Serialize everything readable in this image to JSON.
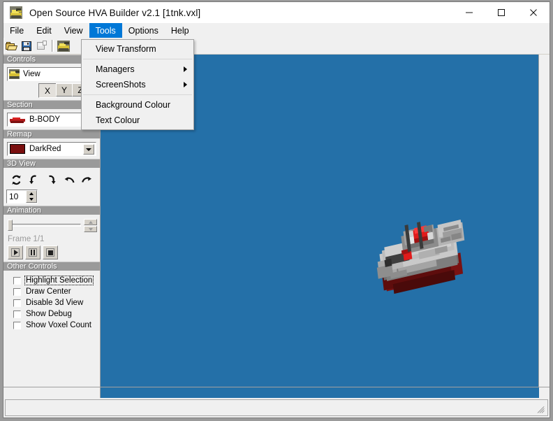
{
  "window": {
    "title": "Open Source HVA Builder v2.1 [1tnk.vxl]",
    "icon": "tank-icon",
    "minimize": "—",
    "maximize": "□",
    "close": "✕"
  },
  "menubar": {
    "items": [
      {
        "label": "File",
        "active": false
      },
      {
        "label": "Edit",
        "active": false
      },
      {
        "label": "View",
        "active": false
      },
      {
        "label": "Tools",
        "active": true
      },
      {
        "label": "Options",
        "active": false
      },
      {
        "label": "Help",
        "active": false
      }
    ]
  },
  "toolbar": {
    "buttons": [
      {
        "name": "open-file-button",
        "icon": "open-folder-icon",
        "enabled": true
      },
      {
        "name": "save-file-button",
        "icon": "floppy-disk-icon",
        "enabled": true
      },
      {
        "name": "save-as-button",
        "icon": "save-as-icon",
        "enabled": false
      },
      {
        "name": "voxel-preview-button",
        "icon": "tank-icon",
        "enabled": true
      },
      {
        "name": "undo-button",
        "icon": "undo-arrow-icon",
        "enabled": false
      },
      {
        "name": "redo-button",
        "icon": "redo-arrow-icon",
        "enabled": false
      }
    ]
  },
  "tools_menu": {
    "items": [
      {
        "label": "View Transform",
        "submenu": false
      },
      {
        "label": "Managers",
        "submenu": true
      },
      {
        "label": "ScreenShots",
        "submenu": true
      },
      {
        "label": "Background Colour",
        "submenu": false
      },
      {
        "label": "Text Colour",
        "submenu": false
      }
    ]
  },
  "sidebar": {
    "groups": [
      {
        "title": "Controls"
      },
      {
        "title": "Section"
      },
      {
        "title": "Remap"
      },
      {
        "title": "3D View"
      },
      {
        "title": "Animation"
      },
      {
        "title": "Other Controls"
      }
    ],
    "controls": {
      "view_label": "View",
      "axis_buttons": [
        {
          "label": "X",
          "selected": true
        },
        {
          "label": "Y",
          "selected": false
        },
        {
          "label": "Z",
          "selected": false
        }
      ]
    },
    "section": {
      "selected": "B-BODY",
      "swatch": "#b11b1b"
    },
    "remap": {
      "selected": "DarkRed",
      "swatch": "#7a0f0f"
    },
    "view3d": {
      "rotate_buttons": [
        "rotate-reset-icon",
        "rotate-left-down-icon",
        "rotate-right-up-icon",
        "rotate-ccw-icon",
        "rotate-cw-icon"
      ],
      "step_value": "10"
    },
    "animation": {
      "frame_label": "Frame 1/1",
      "slider_value": 0,
      "transport": [
        {
          "name": "play-button",
          "icon": "play-icon"
        },
        {
          "name": "pause-button",
          "icon": "pause-icon"
        },
        {
          "name": "stop-button",
          "icon": "stop-icon"
        }
      ]
    },
    "other_controls": {
      "checkboxes": [
        {
          "label": "Highlight Selection",
          "checked": false,
          "focused": true
        },
        {
          "label": "Draw Center",
          "checked": false,
          "focused": false
        },
        {
          "label": "Disable 3d View",
          "checked": false,
          "focused": false
        },
        {
          "label": "Show Debug",
          "checked": false,
          "focused": false
        },
        {
          "label": "Show Voxel Count",
          "checked": false,
          "focused": false
        }
      ]
    }
  },
  "viewport": {
    "background_colour": "#2470a8",
    "model_name": "1tnk-voxel-model"
  },
  "statusbar": {
    "text": ""
  },
  "colors": {
    "accent": "#0078d7",
    "viewport_bg": "#2470a8",
    "group_header": "#9a9a9a",
    "face_light": "#c9c9c9",
    "face_mid": "#9c9c9c",
    "face_dark": "#6e6e6e",
    "red": "#e01b1b",
    "dark_red": "#7a1212",
    "barrel": "#3a3a3a"
  }
}
